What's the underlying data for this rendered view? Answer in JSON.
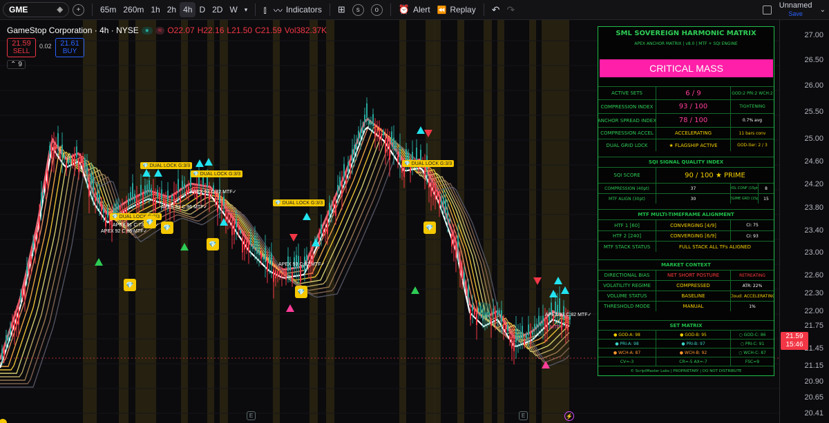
{
  "toolbar": {
    "symbol": "GME",
    "timeframes": [
      "65m",
      "260m",
      "1h",
      "2h",
      "4h",
      "D",
      "2D",
      "W"
    ],
    "active_timeframe": "4h",
    "indicators_label": "Indicators",
    "alert_label": "Alert",
    "replay_label": "Replay",
    "layout_name": "Unnamed",
    "save_label": "Save"
  },
  "legend": {
    "title": "GameStop Corporation · 4h · NYSE",
    "o": "O22.07",
    "h": "H22.16",
    "l": "L21.50",
    "c": "C21.59",
    "vol": "Vol382.37K",
    "sell_price": "21.59",
    "sell_label": "SELL",
    "spread": "0.02",
    "buy_price": "21.61",
    "buy_label": "BUY",
    "indicator_count": "9"
  },
  "price_axis": {
    "ticks": [
      "27.00",
      "26.50",
      "26.00",
      "25.50",
      "25.00",
      "24.60",
      "24.20",
      "23.80",
      "23.40",
      "23.00",
      "22.60",
      "22.30",
      "22.00",
      "21.75",
      "21.45",
      "21.15",
      "20.90",
      "20.65",
      "20.41"
    ],
    "last_price": "21.59",
    "countdown": "15:46"
  },
  "chart_labels": {
    "dual_lock_1": "DUAL LOCK G:3/3",
    "dual_lock_2": "DUAL LOCK G:3/3",
    "dual_lock_3": "DUAL LOCK G:3/3",
    "dual_lock_4": "DUAL LOCK G:3/3",
    "dual_lock_5": "DUAL LOCK G:3/3",
    "apex_1": "APEX 91 C:73 MTF✓",
    "apex_2": "APEX 92 C:86 MTF✓",
    "apex_3": "APEX 93 C:82 MTF✓",
    "apex_4": "APEX 93 C:82 MTF✓",
    "apex_5": "APEX 93 C:82 MTF✓",
    "apex_6": "APEX 93 C:96 MTF✓",
    "mtf_small": "MTF✓"
  },
  "hud": {
    "title": "SML  SOVEREIGN HARMONIC MATRIX",
    "subtitle": "APEX ANCHOR MATRIX  |  v8.0  |  MTF + SQI ENGINE",
    "banner": "CRITICAL MASS",
    "active_sets": {
      "label": "ACTIVE SETS",
      "value": "6 / 9",
      "extra": "GOD:2  PRI:2  WCH:2"
    },
    "compression_index": {
      "label": "COMPRESSION INDEX",
      "value": "93 / 100",
      "extra": "TIGHTENING"
    },
    "anchor_spread": {
      "label": "ANCHOR SPREAD INDEX",
      "value": "78 / 100",
      "extra": "0.7% avg"
    },
    "compression_accel": {
      "label": "COMPRESSION ACCEL",
      "value": "ACCELERATING",
      "extra": "11 bars conv"
    },
    "dual_grid": {
      "label": "DUAL GRID LOCK",
      "value": "★  FLAGSHIP ACTIVE",
      "extra": "GOD-tier: 2 / 3"
    },
    "sqi_header": "SQI  SIGNAL QUALITY INDEX",
    "sqi_score": {
      "label": "SQI SCORE",
      "value": "90 / 100  ★ PRIME"
    },
    "sqi_compression": {
      "label": "COMPRESSION  (40pt)",
      "value": "37",
      "extra_label": "VOL CONF  (15pt)",
      "extra_value": "8"
    },
    "sqi_mtf": {
      "label": "MTF ALIGN  (30pt)",
      "value": "30",
      "extra_label": "REGIME GRD  (15pt)",
      "extra_value": "15"
    },
    "mtf_header": "MTF  MULTI-TIMEFRAME ALIGNMENT",
    "htf1": {
      "label": "HTF 1  [60]",
      "value": "CONVERGING  [4/9]",
      "extra": "CI: 75"
    },
    "htf2": {
      "label": "HTF 2  [240]",
      "value": "CONVERGING  [6/9]",
      "extra": "CI: 93"
    },
    "mtf_stack": {
      "label": "MTF STACK STATUS",
      "value": "FULL STACK  ALL TFs ALIGNED"
    },
    "market_header": "MARKET CONTEXT",
    "bias": {
      "label": "DIRECTIONAL BIAS",
      "value": "NET SHORT POSTURE",
      "extra": "RETREATING"
    },
    "vol_regime": {
      "label": "VOLATILITY REGIME",
      "value": "COMPRESSED",
      "extra": "ATR: 22%"
    },
    "vol_status": {
      "label": "VOLUME STATUS",
      "value": "BASELINE",
      "extra": "Cloud: ACCELERATING"
    },
    "threshold": {
      "label": "THRESHOLD MODE",
      "value": "MANUAL",
      "extra": "1%"
    },
    "set_header": "SET MATRIX",
    "set_rows": [
      [
        "● GOD-A: 98",
        "● GOD-B: 95",
        "○ GOD-C: 86"
      ],
      [
        "● PRI-A: 98",
        "● PRI-B: 97",
        "○ PRI-C: 91"
      ],
      [
        "● WCH-A: 87",
        "● WCH-B: 92",
        "○ WCH-C: 87"
      ],
      [
        "CV=-3",
        "CR=-5  AX=-7",
        "FSC=9"
      ]
    ],
    "footer": "© ScriptMaster Labs  |  PROPRIETARY  |  DO NOT DISTRIBUTE"
  },
  "colors": {
    "up": "#26a69a",
    "down": "#f23645",
    "hud_border": "#1fbf4a",
    "banner": "#ff1fa8",
    "label_yellow": "#f5c800"
  }
}
